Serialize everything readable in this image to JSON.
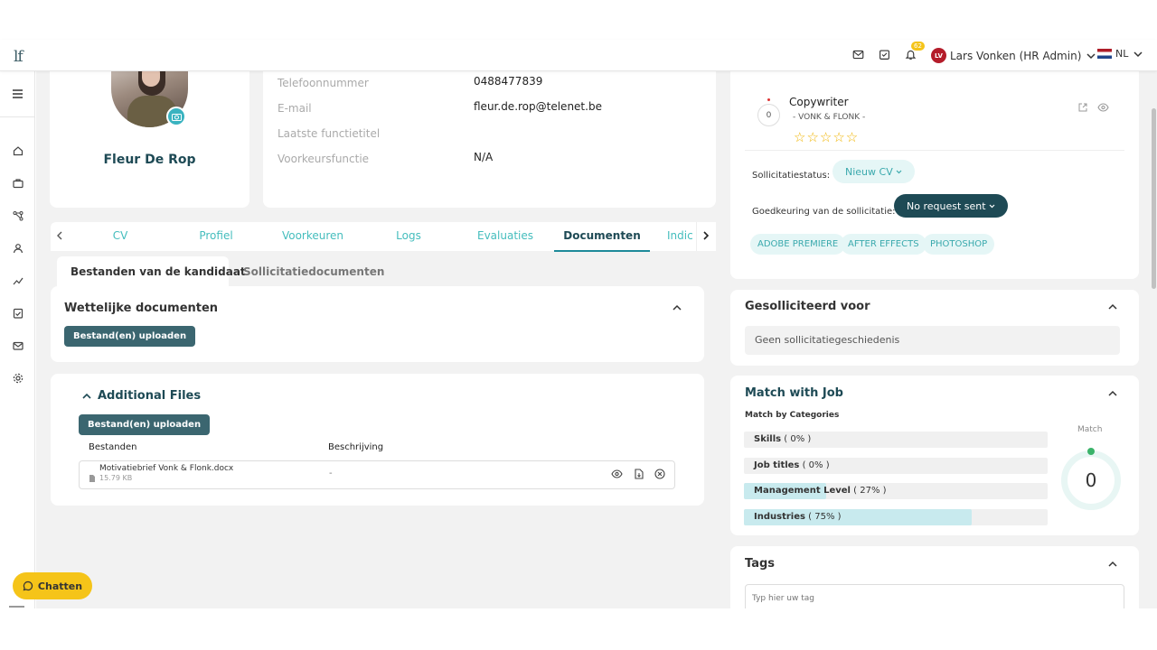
{
  "header": {
    "logo_text": "lf",
    "notification_count": "62",
    "user_initials": "LV",
    "user_name": "Lars Vonken (HR Admin)",
    "language": "NL"
  },
  "sidebar": {
    "items": [
      "menu-icon",
      "home-icon",
      "briefcase-icon",
      "network-icon",
      "user-icon",
      "trend-icon",
      "checklist-icon",
      "mail-icon",
      "gear-icon"
    ]
  },
  "profile": {
    "name": "Fleur De Rop"
  },
  "details": {
    "phone_label": "Telefoonnummer",
    "phone_value": "0488477839",
    "email_label": "E-mail",
    "email_value": "fleur.de.rop@telenet.be",
    "last_title_label": "Laatste functietitel",
    "last_title_value": "",
    "preferred_label": "Voorkeursfunctie",
    "preferred_value": "N/A"
  },
  "tabs": [
    {
      "label": "CV"
    },
    {
      "label": "Profiel"
    },
    {
      "label": "Voorkeuren"
    },
    {
      "label": "Logs"
    },
    {
      "label": "Evaluaties"
    },
    {
      "label": "Documenten"
    },
    {
      "label": "Indic"
    }
  ],
  "subtabs": {
    "candidate_files": "Bestanden van de kandidaat",
    "application_docs": "Sollicitatiedocumenten"
  },
  "legal_docs": {
    "title": "Wettelijke documenten",
    "upload_label": "Bestand(en) uploaden"
  },
  "additional_files": {
    "title": "Additional Files",
    "upload_label": "Bestand(en) uploaden",
    "col_files": "Bestanden",
    "col_description": "Beschrijving",
    "file_name": "Motivatiebrief Vonk & Flonk.docx",
    "file_size": "15.79 KB",
    "file_description": "-"
  },
  "application": {
    "score": "0",
    "job_title": "Copywriter",
    "company": "- VONK & FLONK -",
    "status_label": "Sollicitatiestatus:",
    "status_value": "Nieuw CV",
    "approval_label": "Goedkeuring van de sollicitatie:",
    "approval_value": "No request sent",
    "skills": [
      "ADOBE PREMIERE",
      "AFTER EFFECTS",
      "PHOTOSHOP"
    ]
  },
  "applied_for": {
    "title": "Gesolliciteerd voor",
    "empty_text": "Geen sollicitatiegeschiedenis"
  },
  "match": {
    "title": "Match with Job",
    "subtitle": "Match by Categories",
    "match_label": "Match",
    "match_value": "0",
    "categories": [
      {
        "name": "Skills",
        "pct_text": "( 0% )",
        "pct": 0
      },
      {
        "name": "Job titles",
        "pct_text": "( 0% )",
        "pct": 0
      },
      {
        "name": "Management Level",
        "pct_text": "( 27% )",
        "pct": 27
      },
      {
        "name": "Industries",
        "pct_text": "( 75% )",
        "pct": 75
      }
    ]
  },
  "tags": {
    "title": "Tags",
    "placeholder": "Typ hier uw tag"
  },
  "chat": {
    "label": "Chatten"
  },
  "colors": {
    "primary_dark": "#1e4a55",
    "accent_teal": "#44bdbd",
    "button_dark": "#3b6670",
    "chat_yellow": "#f5c419"
  }
}
